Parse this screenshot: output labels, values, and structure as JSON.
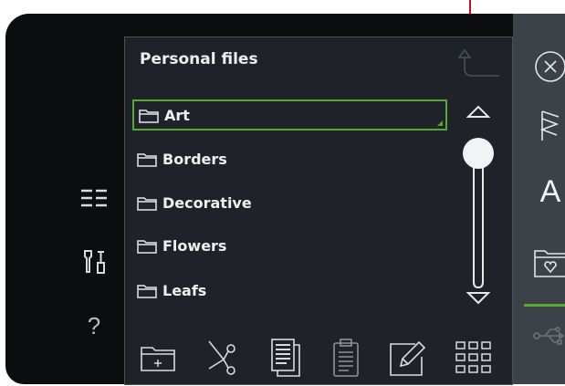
{
  "panel": {
    "title": "Personal files"
  },
  "folders": [
    {
      "label": "Art",
      "selected": true
    },
    {
      "label": "Borders",
      "selected": false
    },
    {
      "label": "Decorative",
      "selected": false
    },
    {
      "label": "Flowers",
      "selected": false
    },
    {
      "label": "Leafs",
      "selected": false
    }
  ],
  "scroll_position": 0,
  "left_icons": [
    "list-view-icon",
    "tools-icon",
    "help-icon"
  ],
  "help_glyph": "?",
  "toolbar_icons": [
    "new-folder-icon",
    "cut-icon",
    "copy-icon",
    "paste-icon",
    "rename-icon",
    "grid-view-icon"
  ],
  "right_icons": [
    "close-icon",
    "stitch-menu-icon",
    "font-menu-icon",
    "file-manager-icon",
    "usb-icon"
  ],
  "font_glyph": "A",
  "colors": {
    "selection_border": "#5aa632",
    "panel_bg": "#1f2329",
    "right_bar_bg": "#3d4249",
    "device_bg": "#0c0d0f"
  }
}
